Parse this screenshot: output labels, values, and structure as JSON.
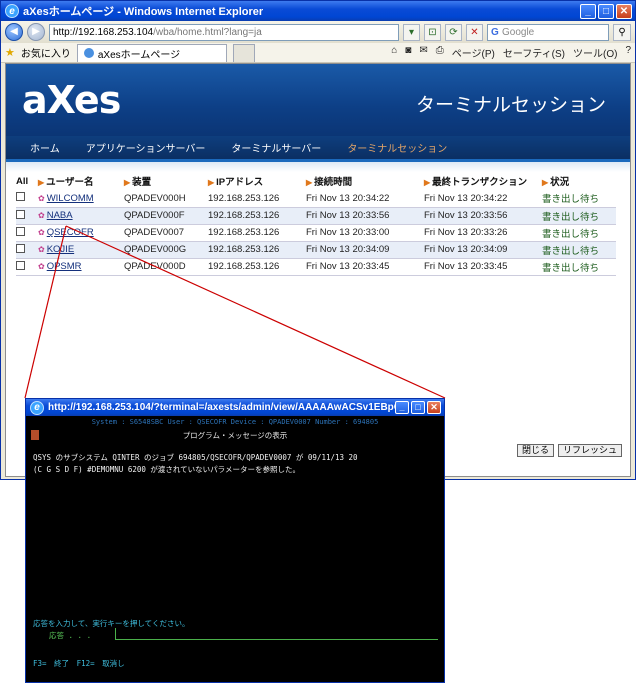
{
  "browser": {
    "title": "aXesホームページ - Windows Internet Explorer",
    "url_host": "http://192.168.253.104",
    "url_path": "/wba/home.html?lang=ja",
    "search_placeholder": "Google",
    "favorites_label": "お気に入り",
    "tab_title": "aXesホームページ",
    "tools": {
      "page": "ページ(P)",
      "safety": "セーフティ(S)",
      "tools": "ツール(O)",
      "help": "?"
    }
  },
  "banner": {
    "logo": "aXes",
    "page_title": "ターミナルセッション"
  },
  "menu": {
    "items": [
      "ホーム",
      "アプリケーションサーバー",
      "ターミナルサーバー",
      "ターミナルセッション"
    ],
    "active_index": 3
  },
  "table": {
    "select_all": "All",
    "headers": [
      "ユーザー名",
      "装置",
      "IPアドレス",
      "接続時間",
      "最終トランザクション",
      "状況"
    ],
    "rows": [
      {
        "user": "WILCOMM",
        "device": "QPADEV000H",
        "ip": "192.168.253.126",
        "connected": "Fri Nov 13 20:34:22",
        "last": "Fri Nov 13 20:34:22",
        "status": "書き出し待ち"
      },
      {
        "user": "NABA",
        "device": "QPADEV000F",
        "ip": "192.168.253.126",
        "connected": "Fri Nov 13 20:33:56",
        "last": "Fri Nov 13 20:33:56",
        "status": "書き出し待ち"
      },
      {
        "user": "QSECOFR",
        "device": "QPADEV0007",
        "ip": "192.168.253.126",
        "connected": "Fri Nov 13 20:33:00",
        "last": "Fri Nov 13 20:33:26",
        "status": "書き出し待ち"
      },
      {
        "user": "KOJIE",
        "device": "QPADEV000G",
        "ip": "192.168.253.126",
        "connected": "Fri Nov 13 20:34:09",
        "last": "Fri Nov 13 20:34:09",
        "status": "書き出し待ち"
      },
      {
        "user": "OPSMR",
        "device": "QPADEV000D",
        "ip": "192.168.253.126",
        "connected": "Fri Nov 13 20:33:45",
        "last": "Fri Nov 13 20:33:45",
        "status": "書き出し待ち"
      }
    ]
  },
  "page_buttons": {
    "close": "閉じる",
    "refresh": "リフレッシュ"
  },
  "terminal": {
    "title": "http://192.168.253.104/?terminal=/axests/admin/view/AAAAAwACSv1EBpG0VVpL...",
    "info": "System : S6548SBC  User : QSECOFR  Device : QPADEV0007  Number : 694805",
    "heading": "プログラム・メッセージの表示",
    "message_line1": "QSYS のサブシステム QINTER のジョブ 694805/QSECOFR/QPADEV0007 が 09/11/13 20",
    "message_line2": "(C G S D F) #DEMOMNU 6200 が渡されていないパラメーターを参照した。",
    "prompt": "応答を入力して、実行キーを押してください。",
    "reply_label": "応答 . . .",
    "fkeys": "F3= 終了    F12= 取消し"
  },
  "colors": {
    "connector": "#cc0000",
    "banner": "#0d3f86",
    "menu_active": "#e4a568"
  }
}
